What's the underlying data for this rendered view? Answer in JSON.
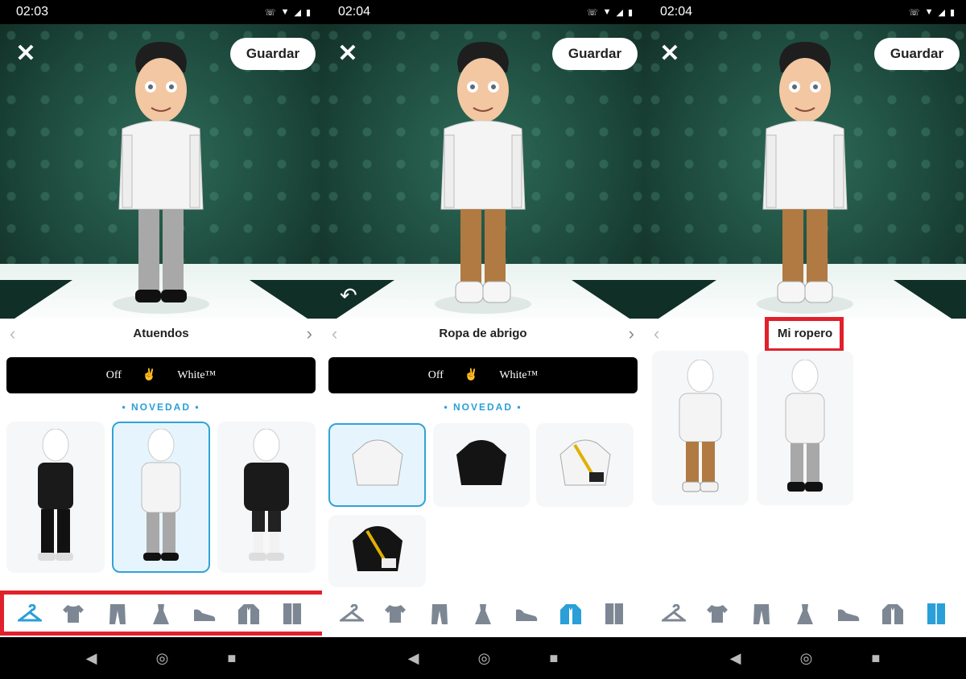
{
  "screens": [
    {
      "status_time": "02:03",
      "save_label": "Guardar",
      "panel_title": "Atuendos",
      "brand_left": "Off",
      "brand_right": "White™",
      "novedad": "• NOVEDAD •",
      "show_undo": false,
      "active_tool": "hanger-icon"
    },
    {
      "status_time": "02:04",
      "save_label": "Guardar",
      "panel_title": "Ropa de abrigo",
      "brand_left": "Off",
      "brand_right": "White™",
      "novedad": "• NOVEDAD •",
      "show_undo": true,
      "active_tool": "jacket-icon"
    },
    {
      "status_time": "02:04",
      "save_label": "Guardar",
      "panel_title": "Mi ropero",
      "show_undo": false,
      "active_tool": "wardrobe-icon"
    }
  ],
  "toolbar_icons": [
    "hanger-icon",
    "tshirt-icon",
    "pants-icon",
    "dress-icon",
    "shoe-icon",
    "jacket-icon",
    "wardrobe-icon"
  ],
  "colors": {
    "accent": "#2a9fd8",
    "highlight": "#e0202a",
    "hoodie": "#f4f4f4",
    "pants_gray": "#a8a8a8",
    "pants_brown": "#b07a42"
  }
}
